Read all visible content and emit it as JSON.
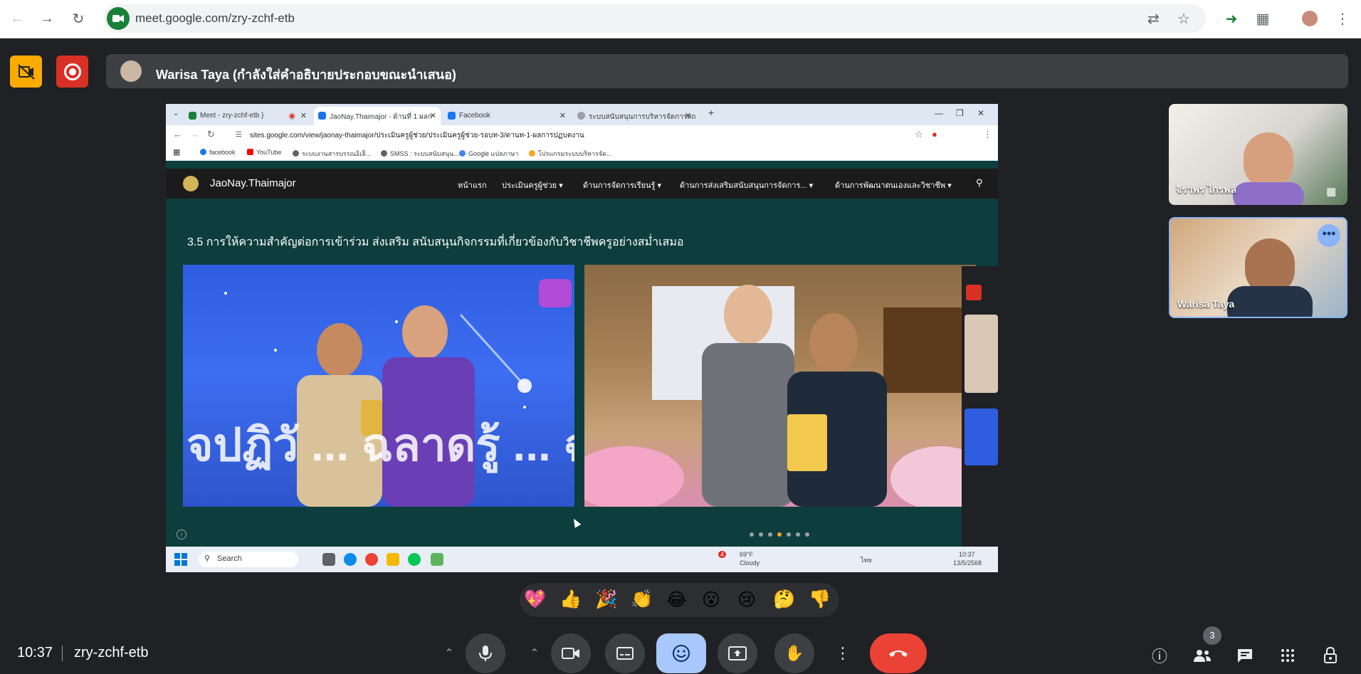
{
  "browser": {
    "url": "meet.google.com/zry-zchf-etb"
  },
  "meet": {
    "presenter_text": "Warisa Taya (กำลังใส่คำอธิบายประกอบขณะนำเสนอ)",
    "meeting_time": "10:37",
    "meeting_code": "zry-zchf-etb",
    "participant_count": "3",
    "tiles": [
      {
        "name": "จิราพร ไกรพล"
      },
      {
        "name": "Warisa Taya"
      }
    ],
    "reactions": [
      "💖",
      "👍",
      "🎉",
      "👏",
      "😂",
      "😮",
      "😢",
      "🤔",
      "👎"
    ]
  },
  "shared_screen": {
    "tabs": [
      {
        "label": "Meet - zry-zchf-etb",
        "color": "#188038"
      },
      {
        "label": "JaoNay.Thaimajor - ด้านที่ 1 ผลก",
        "color": "#1a73e8"
      },
      {
        "label": "Facebook",
        "color": "#1877f2"
      },
      {
        "label": "ระบบสนับสนุนการบริหารจัดการสถา",
        "color": "#5f6368"
      }
    ],
    "url": "sites.google.com/view/jaonay-thaimajor/ประเมินครูผู้ช่วย/ประเมินครูผู้ช่วย-รอบท-3/ดานท-1-ผลการปฏบตงาน",
    "bookmarks": [
      "facebook",
      "YouTube",
      "ระบบงานสารบรรณอิเล็...",
      "SMSS : ระบบสนับสนุน...",
      "Google แปลภาษา",
      "โปรแกรมระบบบริหารจัด..."
    ],
    "site_name": "JaoNay.Thaimajor",
    "site_nav": [
      "หน้าแรก",
      "ประเมินครูผู้ช่วย",
      "ด้านการจัดการเรียนรู้",
      "ด้านการส่งเสริมสนับสนุนการจัดการ...",
      "ด้านการพัฒนาตนเองและวิชาชีพ"
    ],
    "heading": "3.5 การให้ความสำคัญต่อการเข้าร่วม ส่งเสริม สนับสนุนกิจกรรมที่เกี่ยวข้องกับวิชาชีพครูอย่างสม่ำเสมอ",
    "photo1_text": "จปฏิวั ... ฉลาดรู้ ... ฉลาด",
    "photo2_text": "",
    "taskbar": {
      "search": "Search",
      "weather_temp": "69°F",
      "weather_cond": "Cloudy",
      "weather_alert": "4",
      "lang": "ไทย",
      "time": "10:37",
      "date": "13/5/2568"
    }
  }
}
